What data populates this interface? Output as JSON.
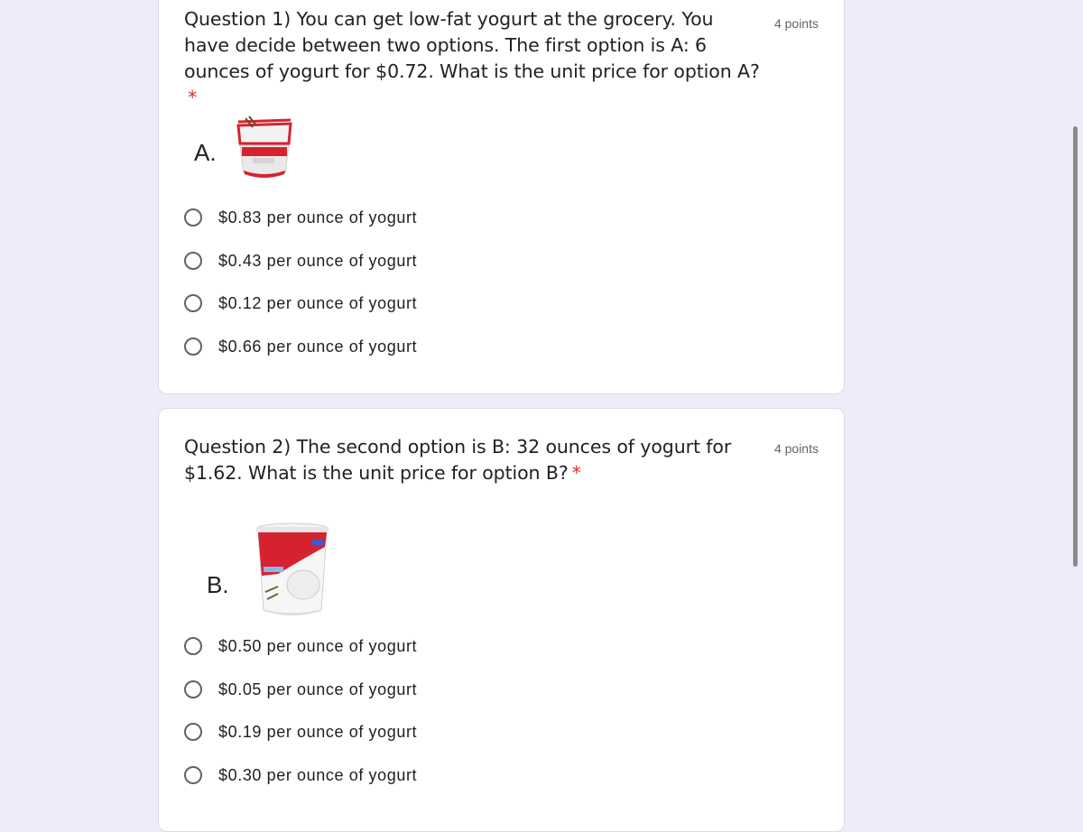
{
  "questions": [
    {
      "title": "Question 1) You can get low-fat yogurt at the grocery. You have decide between two options. The first option is A: 6 ounces of yogurt for $0.72. What is the unit price for option A?",
      "required_mark": "*",
      "points": "4 points",
      "image_label": "A.",
      "options": [
        "$0.83 per ounce of yogurt",
        "$0.43 per ounce of yogurt",
        "$0.12 per ounce of yogurt",
        "$0.66 per ounce of yogurt"
      ]
    },
    {
      "title": "Question 2) The second option is B: 32 ounces of yogurt for $1.62. What is the unit price for option B?",
      "required_mark": "*",
      "points": "4 points",
      "image_label": "B.",
      "options": [
        "$0.50 per ounce of yogurt",
        "$0.05 per ounce of yogurt",
        "$0.19 per ounce of yogurt",
        "$0.30 per ounce of yogurt"
      ]
    }
  ],
  "colors": {
    "background": "#f0ebf8",
    "required": "#d93025",
    "yogurt_red": "#d6222f"
  }
}
